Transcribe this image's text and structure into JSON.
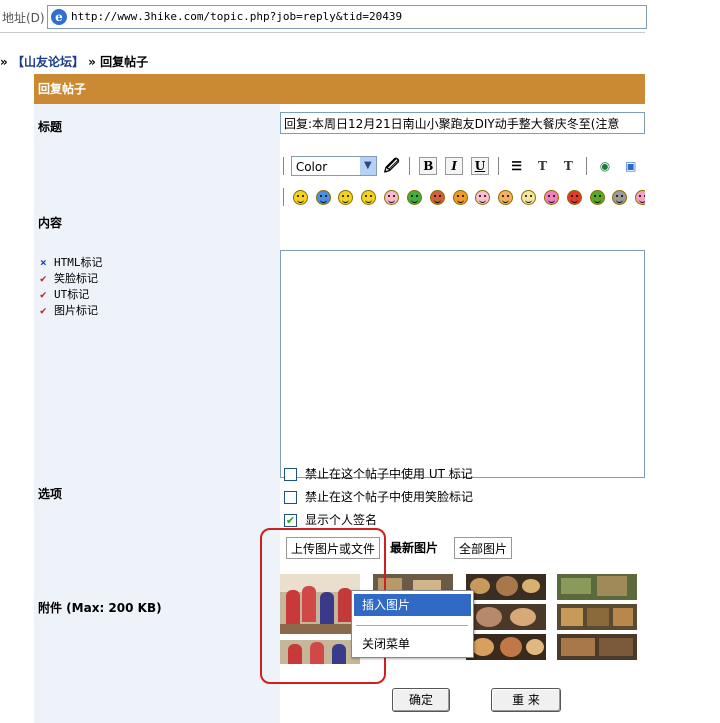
{
  "browser": {
    "address_label": "地址(D)",
    "url": "http://www.3hike.com/topic.php?job=reply&tid=20439"
  },
  "breadcrumb": {
    "separator1": "»",
    "forum_link": "【山友论坛】",
    "separator2": "»",
    "current": "回复帖子"
  },
  "form": {
    "header": "回复帖子",
    "title_label": "标题",
    "title_value": "回复:本周日12月21日南山小聚跑友DIY动手整大餐庆冬至(注意",
    "content_label": "内容",
    "toolbar": {
      "color_select": "Color",
      "bold": "B",
      "italic": "I",
      "underline": "U"
    },
    "markup_settings": [
      {
        "mark": "×",
        "label": "HTML标记",
        "color": "#1a3cc8"
      },
      {
        "mark": "✔",
        "label": "笑脸标记",
        "color": "#d01f1f"
      },
      {
        "mark": "✔",
        "label": "UT标记",
        "color": "#d01f1f"
      },
      {
        "mark": "✔",
        "label": "图片标记",
        "color": "#d01f1f"
      }
    ],
    "options_label": "选项",
    "options": [
      {
        "label": "禁止在这个帖子中使用 UT 标记",
        "checked": false
      },
      {
        "label": "禁止在这个帖子中使用笑脸标记",
        "checked": false
      },
      {
        "label": "显示个人签名",
        "checked": true
      }
    ],
    "attachments_label": "附件 (Max: 200 KB)",
    "attachment_tabs": {
      "upload": "上传图片或文件",
      "latest": "最新图片",
      "all": "全部图片"
    },
    "context_menu": {
      "insert": "插入图片",
      "close": "关闭菜单"
    },
    "submit_button": "确定",
    "reset_button": "重 来"
  },
  "colors": {
    "header_bg": "#c98a33",
    "panel_bg": "#eef3fa",
    "highlight": "#316ac5",
    "annotation": "#d01f1f"
  }
}
